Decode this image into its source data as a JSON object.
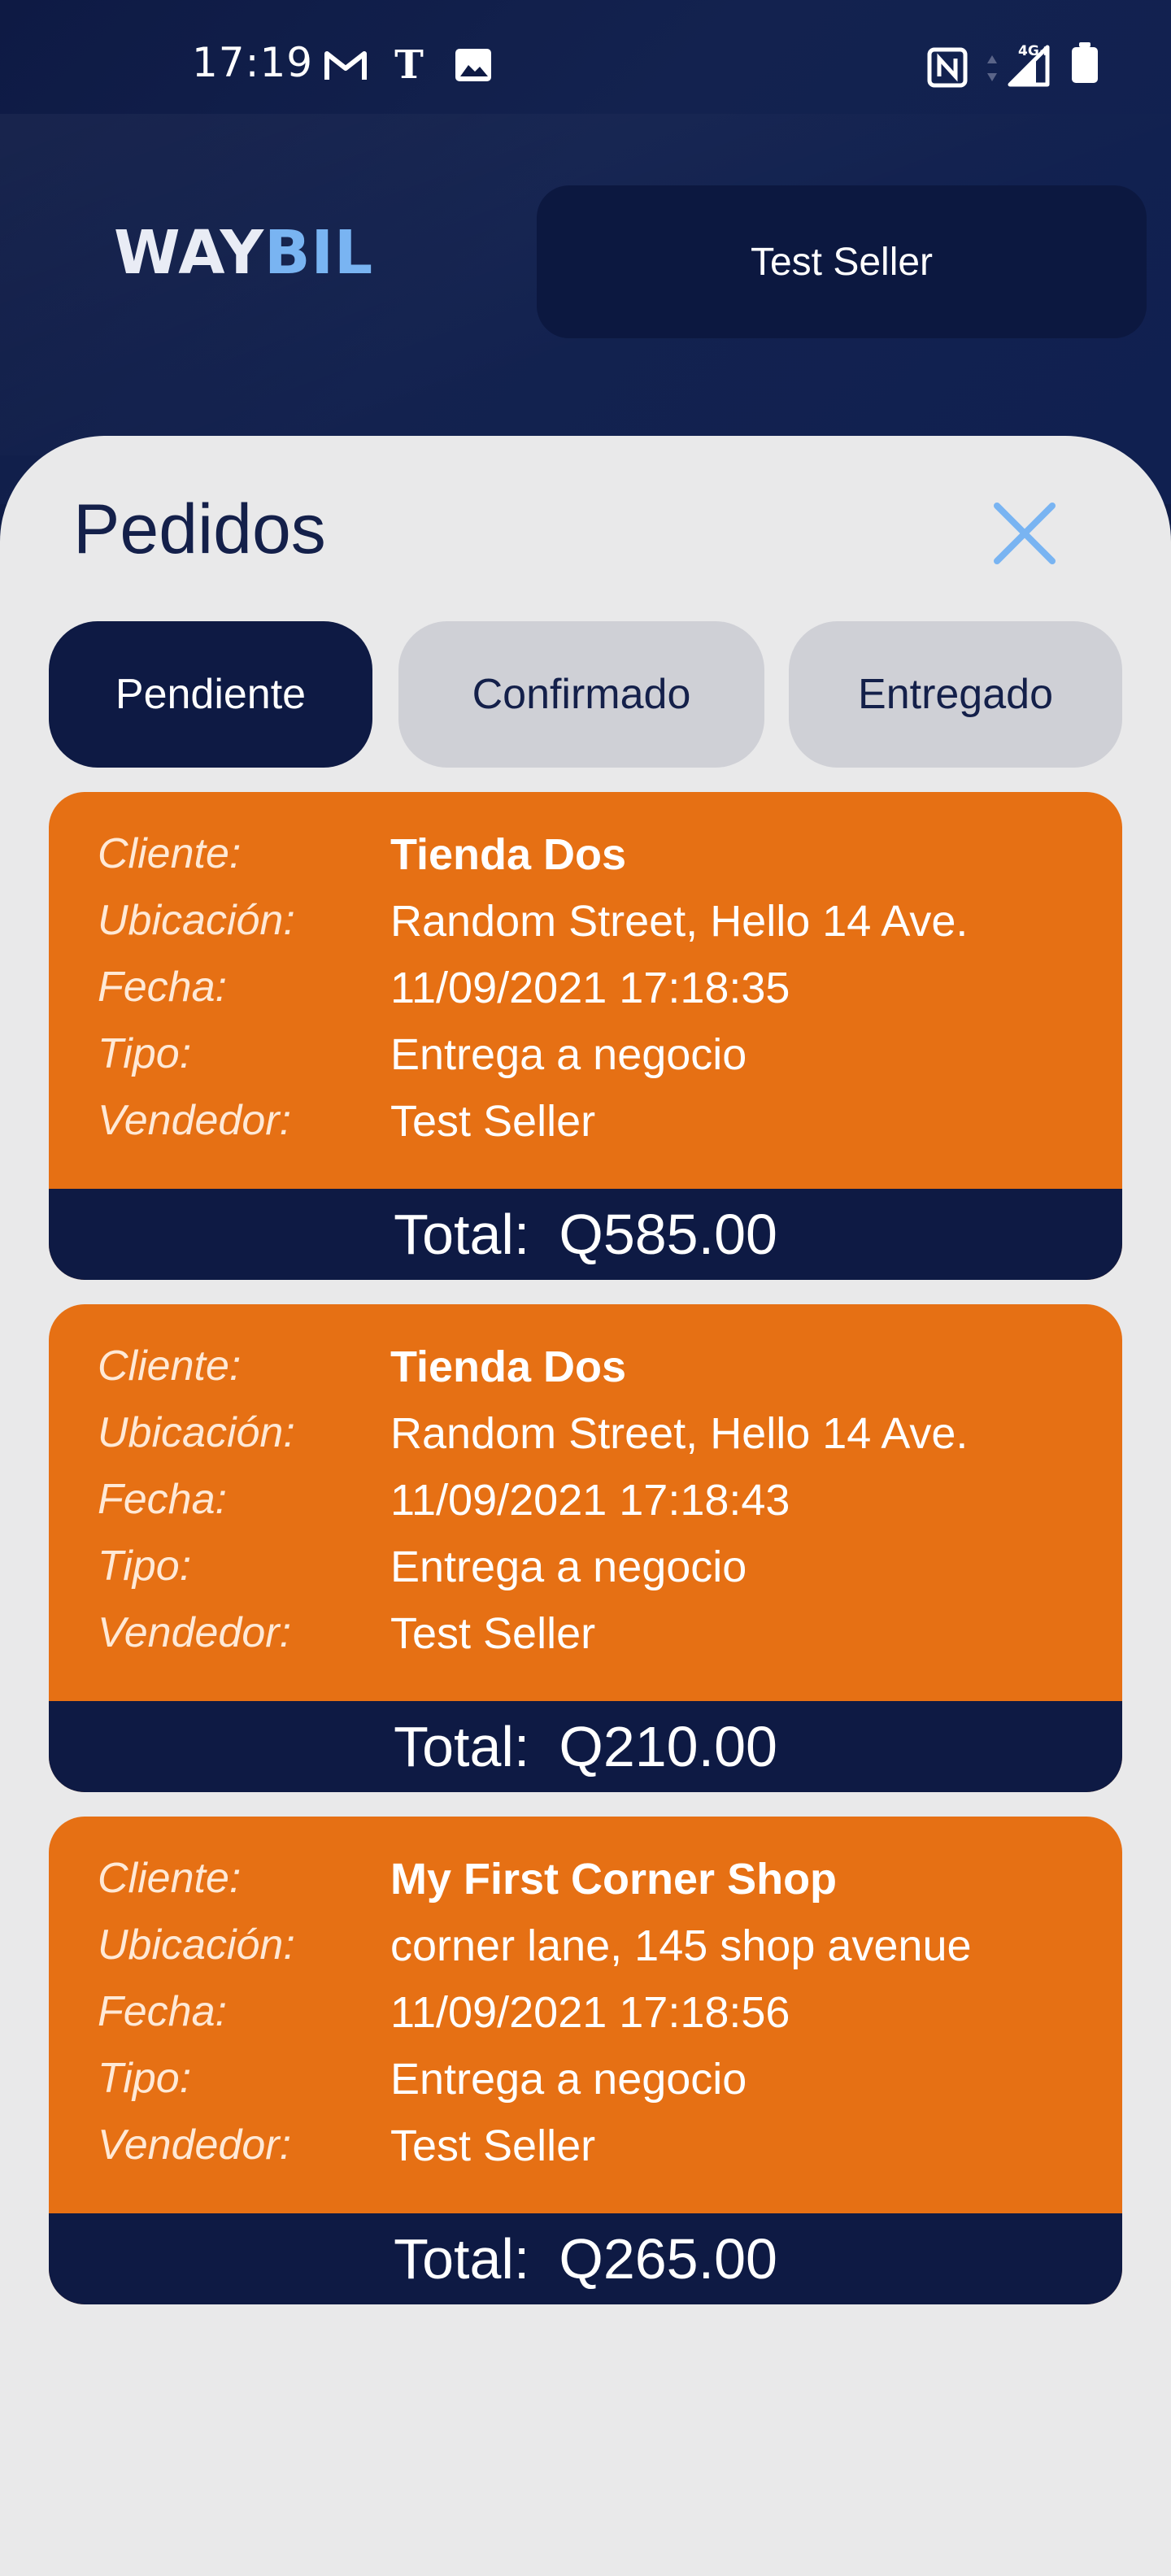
{
  "status_bar": {
    "time": "17:19",
    "icons": [
      "gmail-icon",
      "nytimes-icon",
      "image-icon",
      "nfc-icon",
      "signal-4g-icon",
      "battery-icon"
    ],
    "network_label": "4G+"
  },
  "header": {
    "logo_part1": "WAY",
    "logo_part2": "BIL",
    "seller_label": "Test Seller"
  },
  "sheet": {
    "title": "Pedidos",
    "close_icon": "close-icon"
  },
  "tabs": [
    {
      "label": "Pendiente",
      "active": true
    },
    {
      "label": "Confirmado",
      "active": false
    },
    {
      "label": "Entregado",
      "active": false
    }
  ],
  "field_labels": {
    "cliente": "Cliente:",
    "ubicacion": "Ubicación:",
    "fecha": "Fecha:",
    "tipo": "Tipo:",
    "vendedor": "Vendedor:",
    "total": "Total:"
  },
  "orders": [
    {
      "cliente": "Tienda Dos",
      "ubicacion": "Random Street, Hello 14 Ave.",
      "fecha": "11/09/2021 17:18:35",
      "tipo": "Entrega a negocio",
      "vendedor": "Test Seller",
      "total": "Q585.00"
    },
    {
      "cliente": "Tienda Dos",
      "ubicacion": "Random Street, Hello 14 Ave.",
      "fecha": "11/09/2021 17:18:43",
      "tipo": "Entrega a negocio",
      "vendedor": "Test Seller",
      "total": "Q210.00"
    },
    {
      "cliente": "My First Corner Shop",
      "ubicacion": "corner lane, 145 shop avenue",
      "fecha": "11/09/2021 17:18:56",
      "tipo": "Entrega a negocio",
      "vendedor": "Test Seller",
      "total": "Q265.00"
    }
  ],
  "colors": {
    "header_bg": "#0e1a44",
    "accent_blue": "#79b4f2",
    "card_orange": "#e67014",
    "sheet_bg": "#e9e9ea",
    "tab_inactive": "#cfd0d6"
  }
}
